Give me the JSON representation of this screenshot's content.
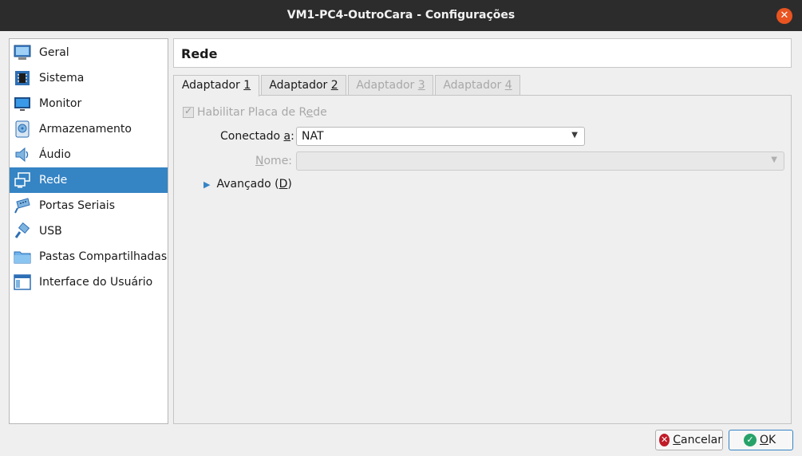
{
  "window": {
    "title": "VM1-PC4-OutroCara - Configurações",
    "close_glyph": "✕"
  },
  "sidebar": {
    "items": [
      {
        "label": "Geral",
        "icon": "general-monitor-icon"
      },
      {
        "label": "Sistema",
        "icon": "chip-icon"
      },
      {
        "label": "Monitor",
        "icon": "display-icon"
      },
      {
        "label": "Armazenamento",
        "icon": "disk-icon"
      },
      {
        "label": "Áudio",
        "icon": "speaker-icon"
      },
      {
        "label": "Rede",
        "icon": "network-icon",
        "selected": true
      },
      {
        "label": "Portas Seriais",
        "icon": "serial-port-icon"
      },
      {
        "label": "USB",
        "icon": "usb-icon"
      },
      {
        "label": "Pastas Compartilhadas",
        "icon": "shared-folder-icon"
      },
      {
        "label": "Interface do Usuário",
        "icon": "user-interface-icon"
      }
    ]
  },
  "header": {
    "title": "Rede"
  },
  "tabs": [
    {
      "label": "Adaptador ",
      "key": "1",
      "active": true,
      "enabled": true
    },
    {
      "label": "Adaptador ",
      "key": "2",
      "active": false,
      "enabled": true
    },
    {
      "label": "Adaptador ",
      "key": "3",
      "active": false,
      "enabled": false
    },
    {
      "label": "Adaptador ",
      "key": "4",
      "active": false,
      "enabled": false
    }
  ],
  "adapter": {
    "enable_label_pre": "Habilitar Placa de R",
    "enable_label_key": "e",
    "enable_label_post": "de",
    "enable_checked": true,
    "attached_label_pre": "Conectado ",
    "attached_label_key": "a",
    "attached_label_post": ":",
    "attached_value": "NAT",
    "name_label_key": "N",
    "name_label_post": "ome:",
    "name_value": "",
    "advanced_label_pre": "Avançado (",
    "advanced_label_key": "D",
    "advanced_label_post": ")"
  },
  "buttons": {
    "cancel_pre": "",
    "cancel_key": "C",
    "cancel_post": "ancelar",
    "ok_pre": "",
    "ok_key": "O",
    "ok_post": "K"
  },
  "colors": {
    "titlebar": "#2c2c2c",
    "close": "#e95420",
    "selection": "#3584c4",
    "cancel_icon": "#c01c28",
    "ok_icon": "#26a269"
  }
}
